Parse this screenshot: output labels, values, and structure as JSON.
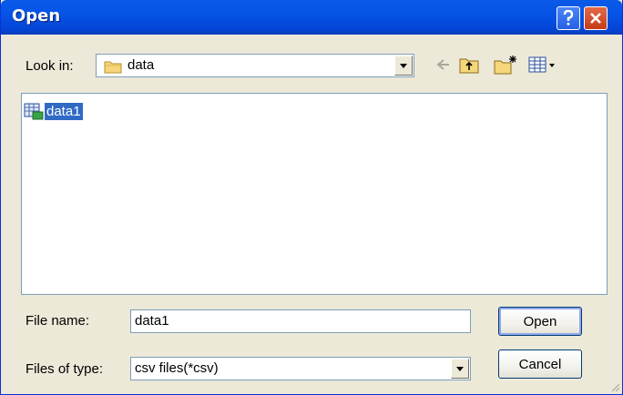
{
  "window": {
    "title": "Open"
  },
  "toolbar": {
    "look_in_label": "Look in:",
    "look_in_value": "data",
    "icons": [
      "back-icon",
      "up-folder-icon",
      "new-folder-icon",
      "view-menu-icon"
    ]
  },
  "file_list": {
    "items": [
      {
        "name": "data1",
        "icon": "csv-file-icon",
        "selected": true
      }
    ]
  },
  "form": {
    "file_name_label": "File name:",
    "file_name_value": "data1",
    "file_type_label": "Files of type:",
    "file_type_value": "csv files(*csv)"
  },
  "buttons": {
    "open": "Open",
    "cancel": "Cancel"
  },
  "colors": {
    "title_bar": "#0654e6",
    "dialog_bg": "#ece9d8",
    "selection": "#316ac5",
    "close_button": "#c63b17"
  }
}
